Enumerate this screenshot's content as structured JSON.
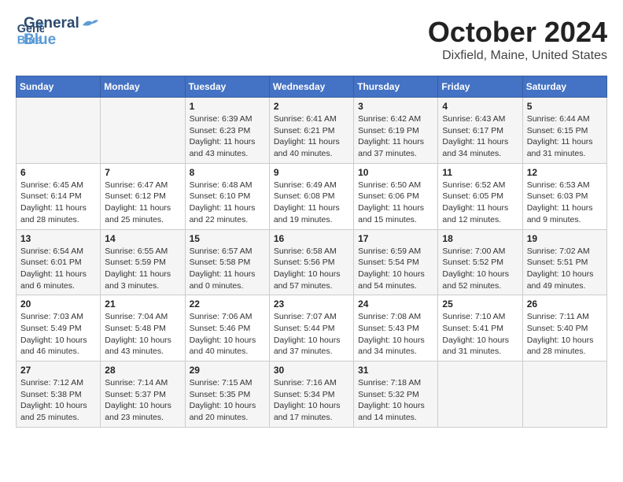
{
  "header": {
    "logo_general": "General",
    "logo_blue": "Blue",
    "title": "October 2024",
    "subtitle": "Dixfield, Maine, United States"
  },
  "calendar": {
    "days_of_week": [
      "Sunday",
      "Monday",
      "Tuesday",
      "Wednesday",
      "Thursday",
      "Friday",
      "Saturday"
    ],
    "weeks": [
      [
        {
          "day": "",
          "sunrise": "",
          "sunset": "",
          "daylight": ""
        },
        {
          "day": "",
          "sunrise": "",
          "sunset": "",
          "daylight": ""
        },
        {
          "day": "1",
          "sunrise": "Sunrise: 6:39 AM",
          "sunset": "Sunset: 6:23 PM",
          "daylight": "Daylight: 11 hours and 43 minutes."
        },
        {
          "day": "2",
          "sunrise": "Sunrise: 6:41 AM",
          "sunset": "Sunset: 6:21 PM",
          "daylight": "Daylight: 11 hours and 40 minutes."
        },
        {
          "day": "3",
          "sunrise": "Sunrise: 6:42 AM",
          "sunset": "Sunset: 6:19 PM",
          "daylight": "Daylight: 11 hours and 37 minutes."
        },
        {
          "day": "4",
          "sunrise": "Sunrise: 6:43 AM",
          "sunset": "Sunset: 6:17 PM",
          "daylight": "Daylight: 11 hours and 34 minutes."
        },
        {
          "day": "5",
          "sunrise": "Sunrise: 6:44 AM",
          "sunset": "Sunset: 6:15 PM",
          "daylight": "Daylight: 11 hours and 31 minutes."
        }
      ],
      [
        {
          "day": "6",
          "sunrise": "Sunrise: 6:45 AM",
          "sunset": "Sunset: 6:14 PM",
          "daylight": "Daylight: 11 hours and 28 minutes."
        },
        {
          "day": "7",
          "sunrise": "Sunrise: 6:47 AM",
          "sunset": "Sunset: 6:12 PM",
          "daylight": "Daylight: 11 hours and 25 minutes."
        },
        {
          "day": "8",
          "sunrise": "Sunrise: 6:48 AM",
          "sunset": "Sunset: 6:10 PM",
          "daylight": "Daylight: 11 hours and 22 minutes."
        },
        {
          "day": "9",
          "sunrise": "Sunrise: 6:49 AM",
          "sunset": "Sunset: 6:08 PM",
          "daylight": "Daylight: 11 hours and 19 minutes."
        },
        {
          "day": "10",
          "sunrise": "Sunrise: 6:50 AM",
          "sunset": "Sunset: 6:06 PM",
          "daylight": "Daylight: 11 hours and 15 minutes."
        },
        {
          "day": "11",
          "sunrise": "Sunrise: 6:52 AM",
          "sunset": "Sunset: 6:05 PM",
          "daylight": "Daylight: 11 hours and 12 minutes."
        },
        {
          "day": "12",
          "sunrise": "Sunrise: 6:53 AM",
          "sunset": "Sunset: 6:03 PM",
          "daylight": "Daylight: 11 hours and 9 minutes."
        }
      ],
      [
        {
          "day": "13",
          "sunrise": "Sunrise: 6:54 AM",
          "sunset": "Sunset: 6:01 PM",
          "daylight": "Daylight: 11 hours and 6 minutes."
        },
        {
          "day": "14",
          "sunrise": "Sunrise: 6:55 AM",
          "sunset": "Sunset: 5:59 PM",
          "daylight": "Daylight: 11 hours and 3 minutes."
        },
        {
          "day": "15",
          "sunrise": "Sunrise: 6:57 AM",
          "sunset": "Sunset: 5:58 PM",
          "daylight": "Daylight: 11 hours and 0 minutes."
        },
        {
          "day": "16",
          "sunrise": "Sunrise: 6:58 AM",
          "sunset": "Sunset: 5:56 PM",
          "daylight": "Daylight: 10 hours and 57 minutes."
        },
        {
          "day": "17",
          "sunrise": "Sunrise: 6:59 AM",
          "sunset": "Sunset: 5:54 PM",
          "daylight": "Daylight: 10 hours and 54 minutes."
        },
        {
          "day": "18",
          "sunrise": "Sunrise: 7:00 AM",
          "sunset": "Sunset: 5:52 PM",
          "daylight": "Daylight: 10 hours and 52 minutes."
        },
        {
          "day": "19",
          "sunrise": "Sunrise: 7:02 AM",
          "sunset": "Sunset: 5:51 PM",
          "daylight": "Daylight: 10 hours and 49 minutes."
        }
      ],
      [
        {
          "day": "20",
          "sunrise": "Sunrise: 7:03 AM",
          "sunset": "Sunset: 5:49 PM",
          "daylight": "Daylight: 10 hours and 46 minutes."
        },
        {
          "day": "21",
          "sunrise": "Sunrise: 7:04 AM",
          "sunset": "Sunset: 5:48 PM",
          "daylight": "Daylight: 10 hours and 43 minutes."
        },
        {
          "day": "22",
          "sunrise": "Sunrise: 7:06 AM",
          "sunset": "Sunset: 5:46 PM",
          "daylight": "Daylight: 10 hours and 40 minutes."
        },
        {
          "day": "23",
          "sunrise": "Sunrise: 7:07 AM",
          "sunset": "Sunset: 5:44 PM",
          "daylight": "Daylight: 10 hours and 37 minutes."
        },
        {
          "day": "24",
          "sunrise": "Sunrise: 7:08 AM",
          "sunset": "Sunset: 5:43 PM",
          "daylight": "Daylight: 10 hours and 34 minutes."
        },
        {
          "day": "25",
          "sunrise": "Sunrise: 7:10 AM",
          "sunset": "Sunset: 5:41 PM",
          "daylight": "Daylight: 10 hours and 31 minutes."
        },
        {
          "day": "26",
          "sunrise": "Sunrise: 7:11 AM",
          "sunset": "Sunset: 5:40 PM",
          "daylight": "Daylight: 10 hours and 28 minutes."
        }
      ],
      [
        {
          "day": "27",
          "sunrise": "Sunrise: 7:12 AM",
          "sunset": "Sunset: 5:38 PM",
          "daylight": "Daylight: 10 hours and 25 minutes."
        },
        {
          "day": "28",
          "sunrise": "Sunrise: 7:14 AM",
          "sunset": "Sunset: 5:37 PM",
          "daylight": "Daylight: 10 hours and 23 minutes."
        },
        {
          "day": "29",
          "sunrise": "Sunrise: 7:15 AM",
          "sunset": "Sunset: 5:35 PM",
          "daylight": "Daylight: 10 hours and 20 minutes."
        },
        {
          "day": "30",
          "sunrise": "Sunrise: 7:16 AM",
          "sunset": "Sunset: 5:34 PM",
          "daylight": "Daylight: 10 hours and 17 minutes."
        },
        {
          "day": "31",
          "sunrise": "Sunrise: 7:18 AM",
          "sunset": "Sunset: 5:32 PM",
          "daylight": "Daylight: 10 hours and 14 minutes."
        },
        {
          "day": "",
          "sunrise": "",
          "sunset": "",
          "daylight": ""
        },
        {
          "day": "",
          "sunrise": "",
          "sunset": "",
          "daylight": ""
        }
      ]
    ]
  }
}
